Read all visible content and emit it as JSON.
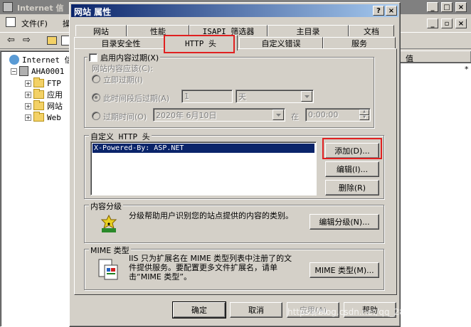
{
  "bg_window": {
    "title": "Internet 信",
    "menu_items": [
      "文件(F)",
      "操"
    ],
    "tree": [
      {
        "label": "Internet 信",
        "level": 0
      },
      {
        "label": "AHA0001",
        "level": 1
      },
      {
        "label": "FTP",
        "level": 2
      },
      {
        "label": "应用",
        "level": 2
      },
      {
        "label": "网站",
        "level": 2
      },
      {
        "label": "Web",
        "level": 2
      }
    ],
    "list_header": "值",
    "list_value": "*"
  },
  "dialog": {
    "title": "网站 属性",
    "title_help": "?",
    "title_close": "×",
    "tabs_row1": [
      "网站",
      "性能",
      "ISAPI 筛选器",
      "主目录",
      "文档"
    ],
    "tabs_row2": [
      "目录安全性",
      "HTTP 头",
      "自定义错误",
      "服务"
    ],
    "active_tab": "HTTP 头",
    "expire": {
      "checkbox_label": "启用内容过期(X)",
      "checked": false,
      "sub_label": "网站内容应该(C):",
      "opt_immediate": "立即过期(I)",
      "opt_after": "此时间段后过期(A)",
      "after_value": "1",
      "after_unit": "天",
      "opt_on": "过期时间(O)",
      "date_value": "2020年 6月10日",
      "at_label": "在",
      "time_value": "0:00:00"
    },
    "custom_http": {
      "group_label": "自定义 HTTP 头",
      "headers": [
        "X-Powered-By: ASP.NET"
      ],
      "add_label": "添加(D)...",
      "edit_label": "编辑(I)...",
      "delete_label": "删除(R)"
    },
    "rating": {
      "group_label": "内容分级",
      "description": "分级帮助用户识别您的站点提供的内容的类别。",
      "edit_label": "编辑分级(N)..."
    },
    "mime": {
      "group_label": "MIME 类型",
      "description": "IIS 只为扩展名在 MIME 类型列表中注册了的文件提供服务。要配置更多文件扩展名，请单击“MIME 类型”。",
      "button_label": "MIME 类型(M)..."
    },
    "footer": {
      "ok": "确定",
      "cancel": "取消",
      "apply": "应用(A)",
      "help": "帮助"
    }
  },
  "watermark": "https://blog.csdn.net/qq_28669073"
}
